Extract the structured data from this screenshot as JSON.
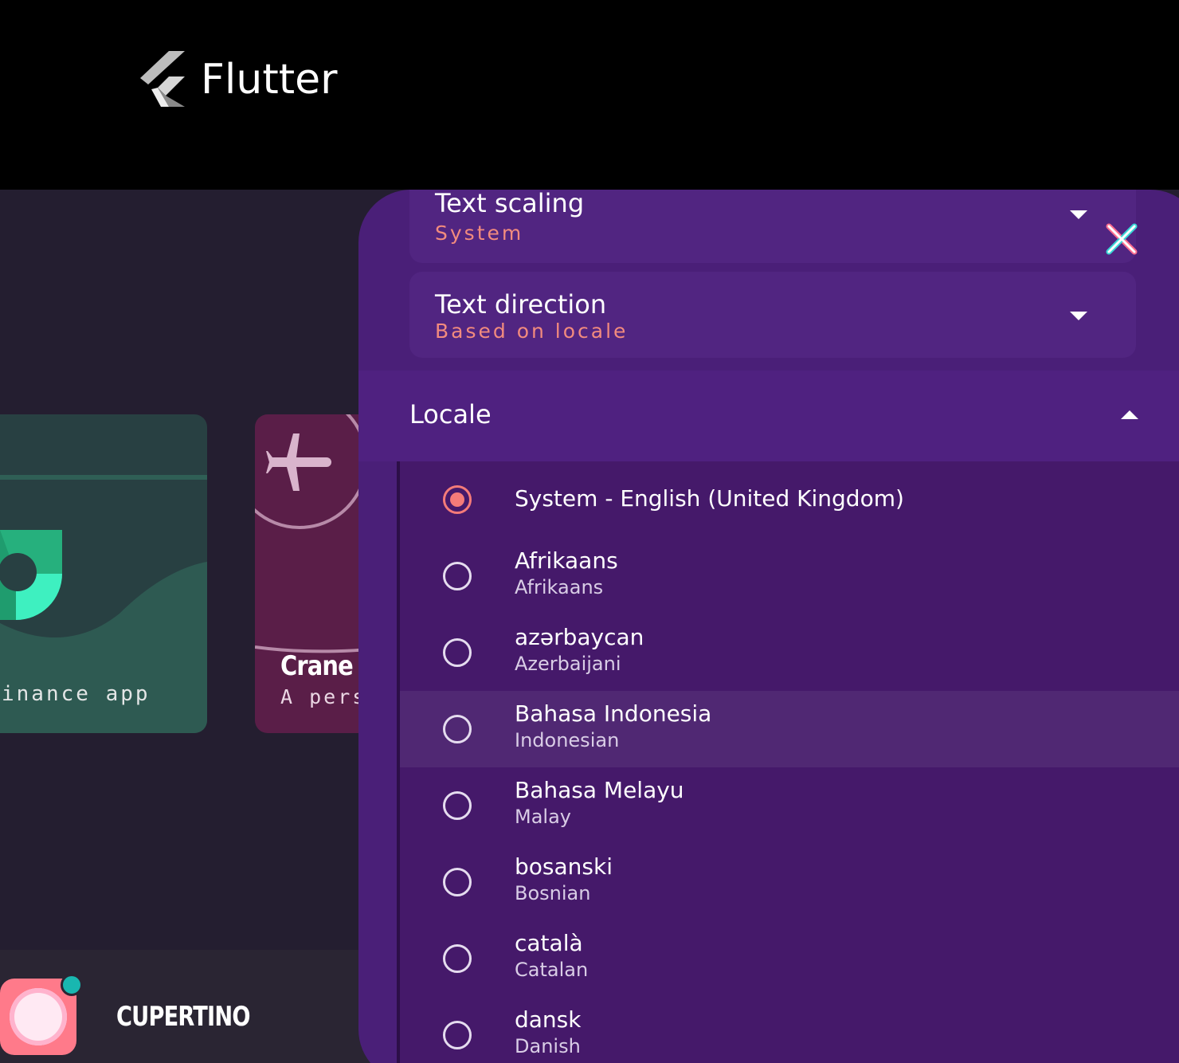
{
  "header": {
    "brand": "Flutter",
    "logo_icon": "flutter-logo-icon"
  },
  "gallery": {
    "finance_card": {
      "subtitle": "inance app"
    },
    "crane_card": {
      "title": "Crane",
      "subtitle": "A perso"
    },
    "cupertino": {
      "label": "CUPERTINO"
    }
  },
  "settings": {
    "close_icon": "close-icon",
    "text_scaling": {
      "title": "Text scaling",
      "value": "System"
    },
    "text_direction": {
      "title": "Text direction",
      "value": "Based on locale"
    },
    "locale": {
      "title": "Locale",
      "options": [
        {
          "name": "System - English (United Kingdom)",
          "sub": "",
          "selected": true
        },
        {
          "name": "Afrikaans",
          "sub": "Afrikaans",
          "selected": false
        },
        {
          "name": "azərbaycan",
          "sub": "Azerbaijani",
          "selected": false
        },
        {
          "name": "Bahasa Indonesia",
          "sub": "Indonesian",
          "selected": false,
          "highlighted": true
        },
        {
          "name": "Bahasa Melayu",
          "sub": "Malay",
          "selected": false
        },
        {
          "name": "bosanski",
          "sub": "Bosnian",
          "selected": false
        },
        {
          "name": "català",
          "sub": "Catalan",
          "selected": false
        },
        {
          "name": "dansk",
          "sub": "Danish",
          "selected": false
        }
      ]
    }
  },
  "colors": {
    "panel": "#4a1f78",
    "accent": "#f47b79",
    "background": "#241e30"
  }
}
